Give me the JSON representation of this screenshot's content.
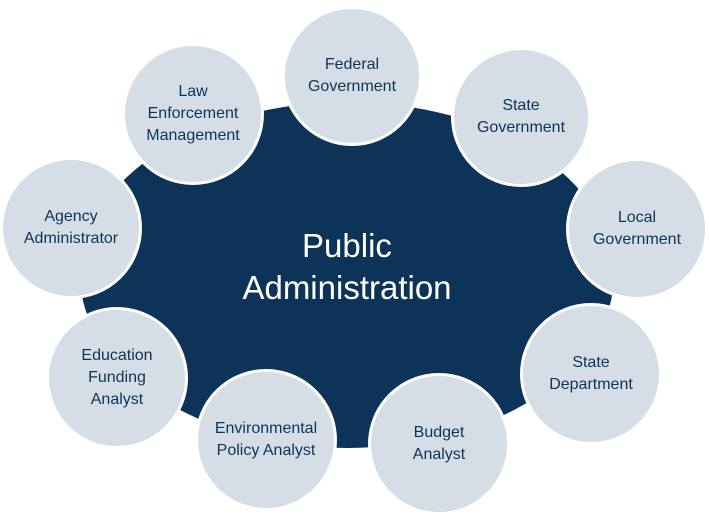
{
  "diagram": {
    "center": {
      "label": "Public\nAdministration"
    },
    "nodes": [
      {
        "label": "Federal\nGovernment"
      },
      {
        "label": "State\nGovernment"
      },
      {
        "label": "Local\nGovernment"
      },
      {
        "label": "State\nDepartment"
      },
      {
        "label": "Budget\nAnalyst"
      },
      {
        "label": "Environmental\nPolicy Analyst"
      },
      {
        "label": "Education\nFunding\nAnalyst"
      },
      {
        "label": "Agency\nAdministrator"
      },
      {
        "label": "Law\nEnforcement\nManagement"
      }
    ]
  },
  "colors": {
    "hub": "#0d3458",
    "node_fill": "#d5dde6",
    "node_text": "#0d3458",
    "hub_text": "#ffffff"
  }
}
